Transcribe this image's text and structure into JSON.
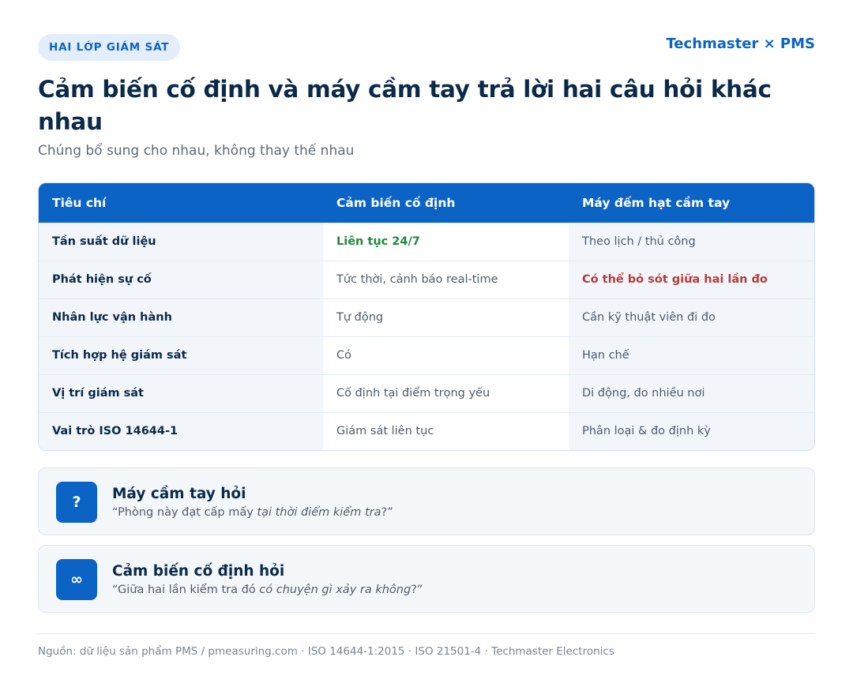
{
  "badge": "HAI LỚP GIÁM SÁT",
  "brand": "Techmaster × PMS",
  "title": "Cảm biến cố định và máy cầm tay trả lời hai câu hỏi khác nhau",
  "subtitle": "Chúng bổ sung cho nhau, không thay thế nhau",
  "table": {
    "headers": [
      "Tiêu chí",
      "Cảm biến cố định",
      "Máy đếm hạt cầm tay"
    ],
    "rows": [
      [
        "Tần suất dữ liệu",
        "Liên tục 24/7",
        "Theo lịch / thủ công"
      ],
      [
        "Phát hiện sự cố",
        "Tức thời, cảnh báo real-time",
        "Có thể bỏ sót giữa hai lần đo"
      ],
      [
        "Nhân lực vận hành",
        "Tự động",
        "Cần kỹ thuật viên đi đo"
      ],
      [
        "Tích hợp hệ giám sát",
        "Có",
        "Hạn chế"
      ],
      [
        "Vị trí giám sát",
        "Cố định tại điểm trọng yếu",
        "Di động, đo nhiều nơi"
      ],
      [
        "Vai trò ISO 14644-1",
        "Giám sát liên tục",
        "Phân loại & đo định kỳ"
      ]
    ]
  },
  "cards": [
    {
      "icon": "?",
      "title": "Máy cầm tay hỏi",
      "quote_before": "“Phòng này đạt cấp mấy ",
      "quote_em": "tại thời điểm kiểm tra",
      "quote_after": "?”"
    },
    {
      "icon": "∞",
      "title": "Cảm biến cố định hỏi",
      "quote_before": "“Giữa hai lần kiểm tra đó ",
      "quote_em": "có chuyện gì xảy ra không",
      "quote_after": "?”"
    }
  ],
  "footer": "Nguồn: dữ liệu sản phẩm PMS / pmeasuring.com · ISO 14644-1:2015 · ISO 21501-4 · Techmaster Electronics",
  "colors": {
    "accent": "#0b63c6",
    "good": "#1f8a3a",
    "bad": "#b83a3a",
    "ink": "#0b2a4a"
  }
}
